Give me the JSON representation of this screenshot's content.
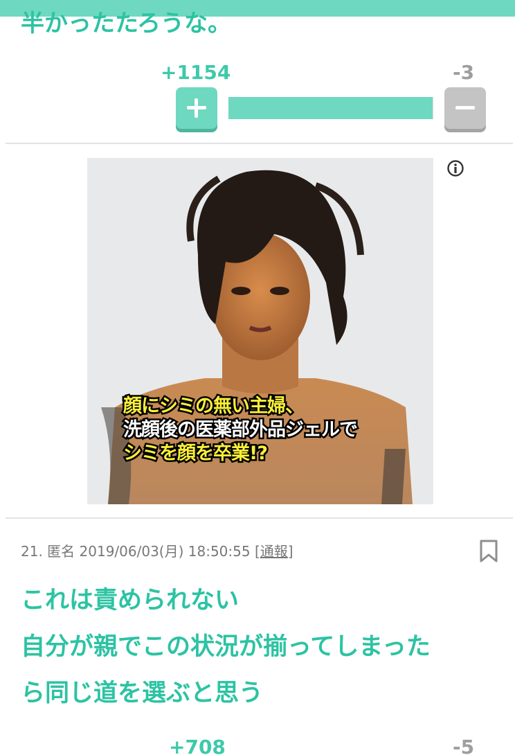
{
  "previous_comment": {
    "text_fragment": "半かったたろうな。",
    "plus_count": "+1154",
    "minus_count": "-3",
    "vote_ratio": 0.997
  },
  "ad": {
    "overlay_lines": [
      "顔にシミの無い主婦、",
      "洗顔後の医薬部外品ジェルで",
      "シミを顔を卒業!?"
    ],
    "info_icon": "info-circle-icon"
  },
  "comment": {
    "number": "21.",
    "author": "匿名",
    "datetime": "2019/06/03(月) 18:50:55",
    "report_open": "[",
    "report_label": "通報",
    "report_close": "]",
    "bookmark_icon": "bookmark-icon",
    "body_lines": [
      "これは責められない",
      "自分が親でこの状況が揃ってしまった",
      "ら同じ道を選ぶと思う"
    ],
    "plus_count": "+708",
    "minus_count": "-5"
  },
  "colors": {
    "accent": "#2cc3a3",
    "bar": "#6fd8c0",
    "minus_gray": "#9e9e9e"
  }
}
